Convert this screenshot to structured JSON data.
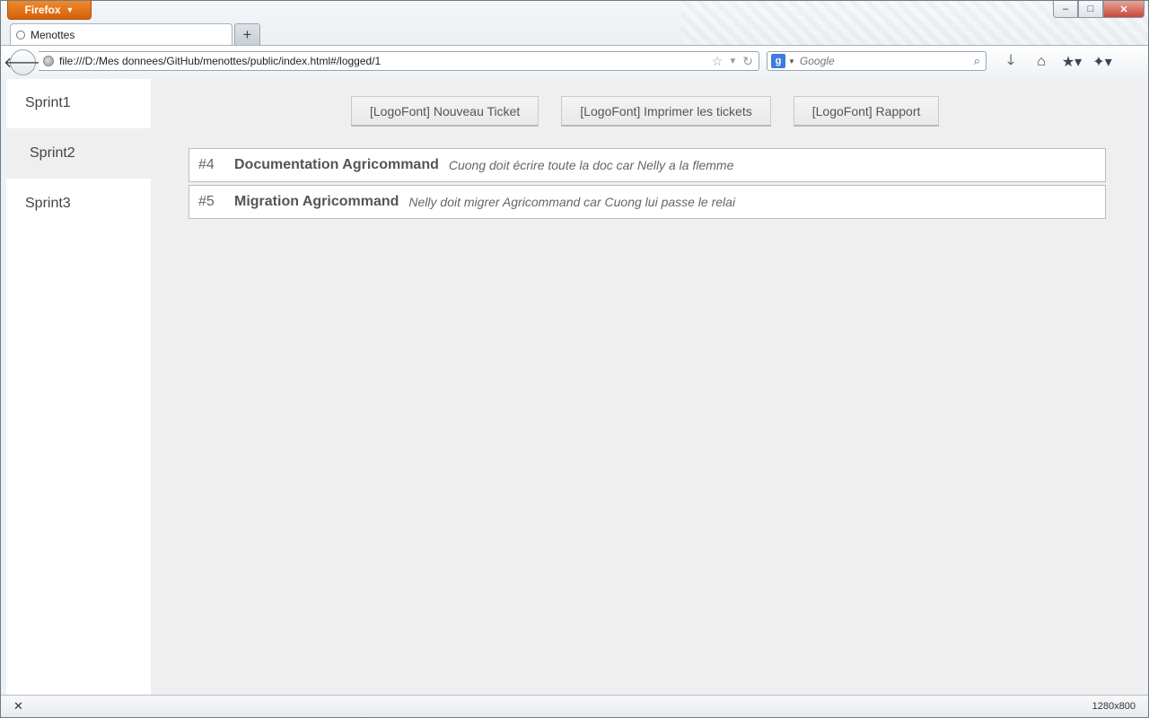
{
  "browser": {
    "app_button_label": "Firefox",
    "tab_title": "Menottes",
    "new_tab_label": "+",
    "url": "file:///D:/Mes donnees/GitHub/menottes/public/index.html#/logged/1",
    "search_engine_letter": "g",
    "search_placeholder": "Google",
    "window_controls": {
      "minimize": "–",
      "maximize": "□",
      "close": "✕"
    }
  },
  "sidebar": {
    "items": [
      {
        "label": "Sprint1",
        "active": false
      },
      {
        "label": "Sprint2",
        "active": true
      },
      {
        "label": "Sprint3",
        "active": false
      }
    ]
  },
  "toolbar": {
    "new_ticket_label": "[LogoFont] Nouveau Ticket",
    "print_tickets_label": "[LogoFont] Imprimer les tickets",
    "report_label": "[LogoFont] Rapport"
  },
  "tickets": [
    {
      "number": "#4",
      "title": "Documentation Agricommand",
      "description": "Cuong doit écrire toute la doc car Nelly a la flemme"
    },
    {
      "number": "#5",
      "title": "Migration Agricommand",
      "description": "Nelly doit migrer Agricommand car Cuong lui passe le relai"
    }
  ],
  "statusbar": {
    "close_label": "✕",
    "size_label": "1280x800"
  },
  "icons": {
    "back": "back-arrow-icon",
    "globe": "globe-icon",
    "bookmark_star": "star-icon",
    "dropdown": "chevron-down-icon",
    "reload": "reload-icon",
    "search": "search-icon",
    "download": "download-icon",
    "home": "home-icon",
    "bookmarks": "bookmarks-menu-icon",
    "addon": "addon-icon"
  }
}
